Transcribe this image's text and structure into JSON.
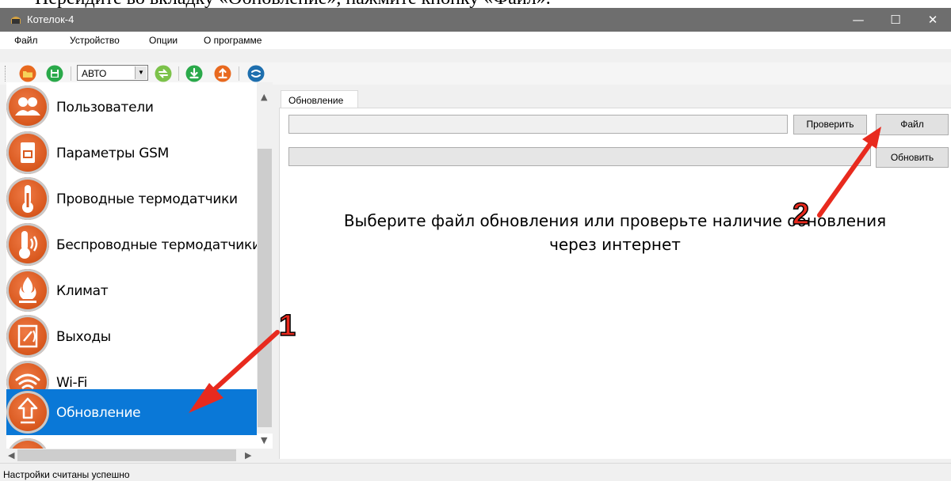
{
  "document": {
    "heading_fragment": "Перейдите во вкладку «Обновление», нажмите кнопку «Файл»."
  },
  "window": {
    "title": "Котелок-4",
    "controls": {
      "minimize": "—",
      "maximize": "☐",
      "close": "✕"
    }
  },
  "menu": {
    "items": [
      "Файл",
      "Устройство",
      "Опции",
      "О программе"
    ]
  },
  "toolbar": {
    "mode_select_value": "АВТО",
    "icons": [
      "open-folder-icon",
      "save-icon",
      "sync-icon",
      "download-icon",
      "upload-icon",
      "refresh-icon"
    ],
    "colors": {
      "orange": "#e8691f",
      "green": "#2aa94a",
      "blue": "#1e6fae"
    }
  },
  "sidebar": {
    "items": [
      {
        "label": "Пользователи",
        "icon": "users-icon"
      },
      {
        "label": "Параметры GSM",
        "icon": "gsm-icon"
      },
      {
        "label": "Проводные термодатчики",
        "icon": "thermometer-icon"
      },
      {
        "label": "Беспроводные термодатчики",
        "icon": "wireless-thermometer-icon"
      },
      {
        "label": "Климат",
        "icon": "flame-icon"
      },
      {
        "label": "Выходы",
        "icon": "relay-icon"
      },
      {
        "label": "Wi-Fi",
        "icon": "wifi-icon"
      },
      {
        "label": "Обновление",
        "icon": "update-icon",
        "selected": true
      }
    ],
    "selected_color": "#0a78d7"
  },
  "main": {
    "tab_label": "Обновление",
    "check_button": "Проверить",
    "file_button": "Файл",
    "update_button": "Обновить",
    "message_line1": "Выберите файл обновления или проверьте наличие обновления",
    "message_line2": "через интернет"
  },
  "annotations": {
    "step1": "1",
    "step2": "2",
    "arrow_color": "#e82a1e"
  },
  "status": {
    "text": "Настройки считаны успешно"
  }
}
